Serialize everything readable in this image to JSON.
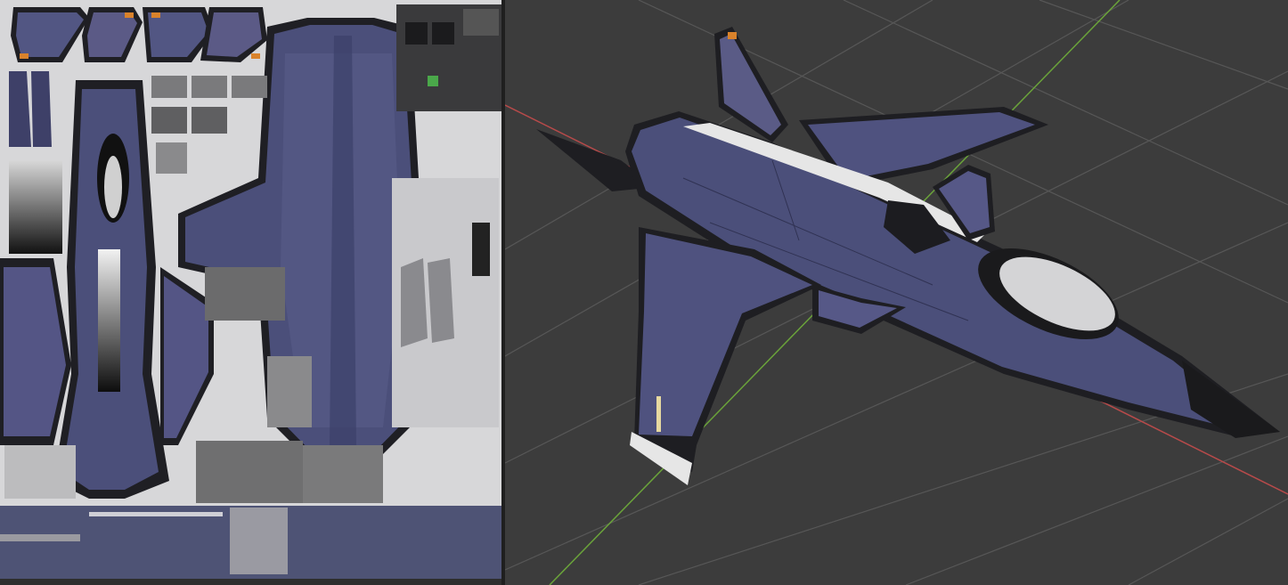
{
  "workspace": {
    "uv_editor": {
      "texture": "aircraft-texture-atlas",
      "background_color": "#d9d9d9",
      "lower_strip_color": "#4e5375"
    },
    "viewport_3d": {
      "background_color": "#3c3c3c",
      "grid_color": "#555555",
      "x_axis_color": "#b74a4a",
      "y_axis_color": "#6aa33a",
      "model": "fighter-jet",
      "model_base_color": "#4b4f7a"
    }
  },
  "colors": {
    "hull_blue": "#4b4f7a",
    "hull_violet": "#6a5f86",
    "trim_dark": "#1e1e22",
    "stripe_white": "#e6e6e6",
    "accent_orange": "#d9822b"
  }
}
